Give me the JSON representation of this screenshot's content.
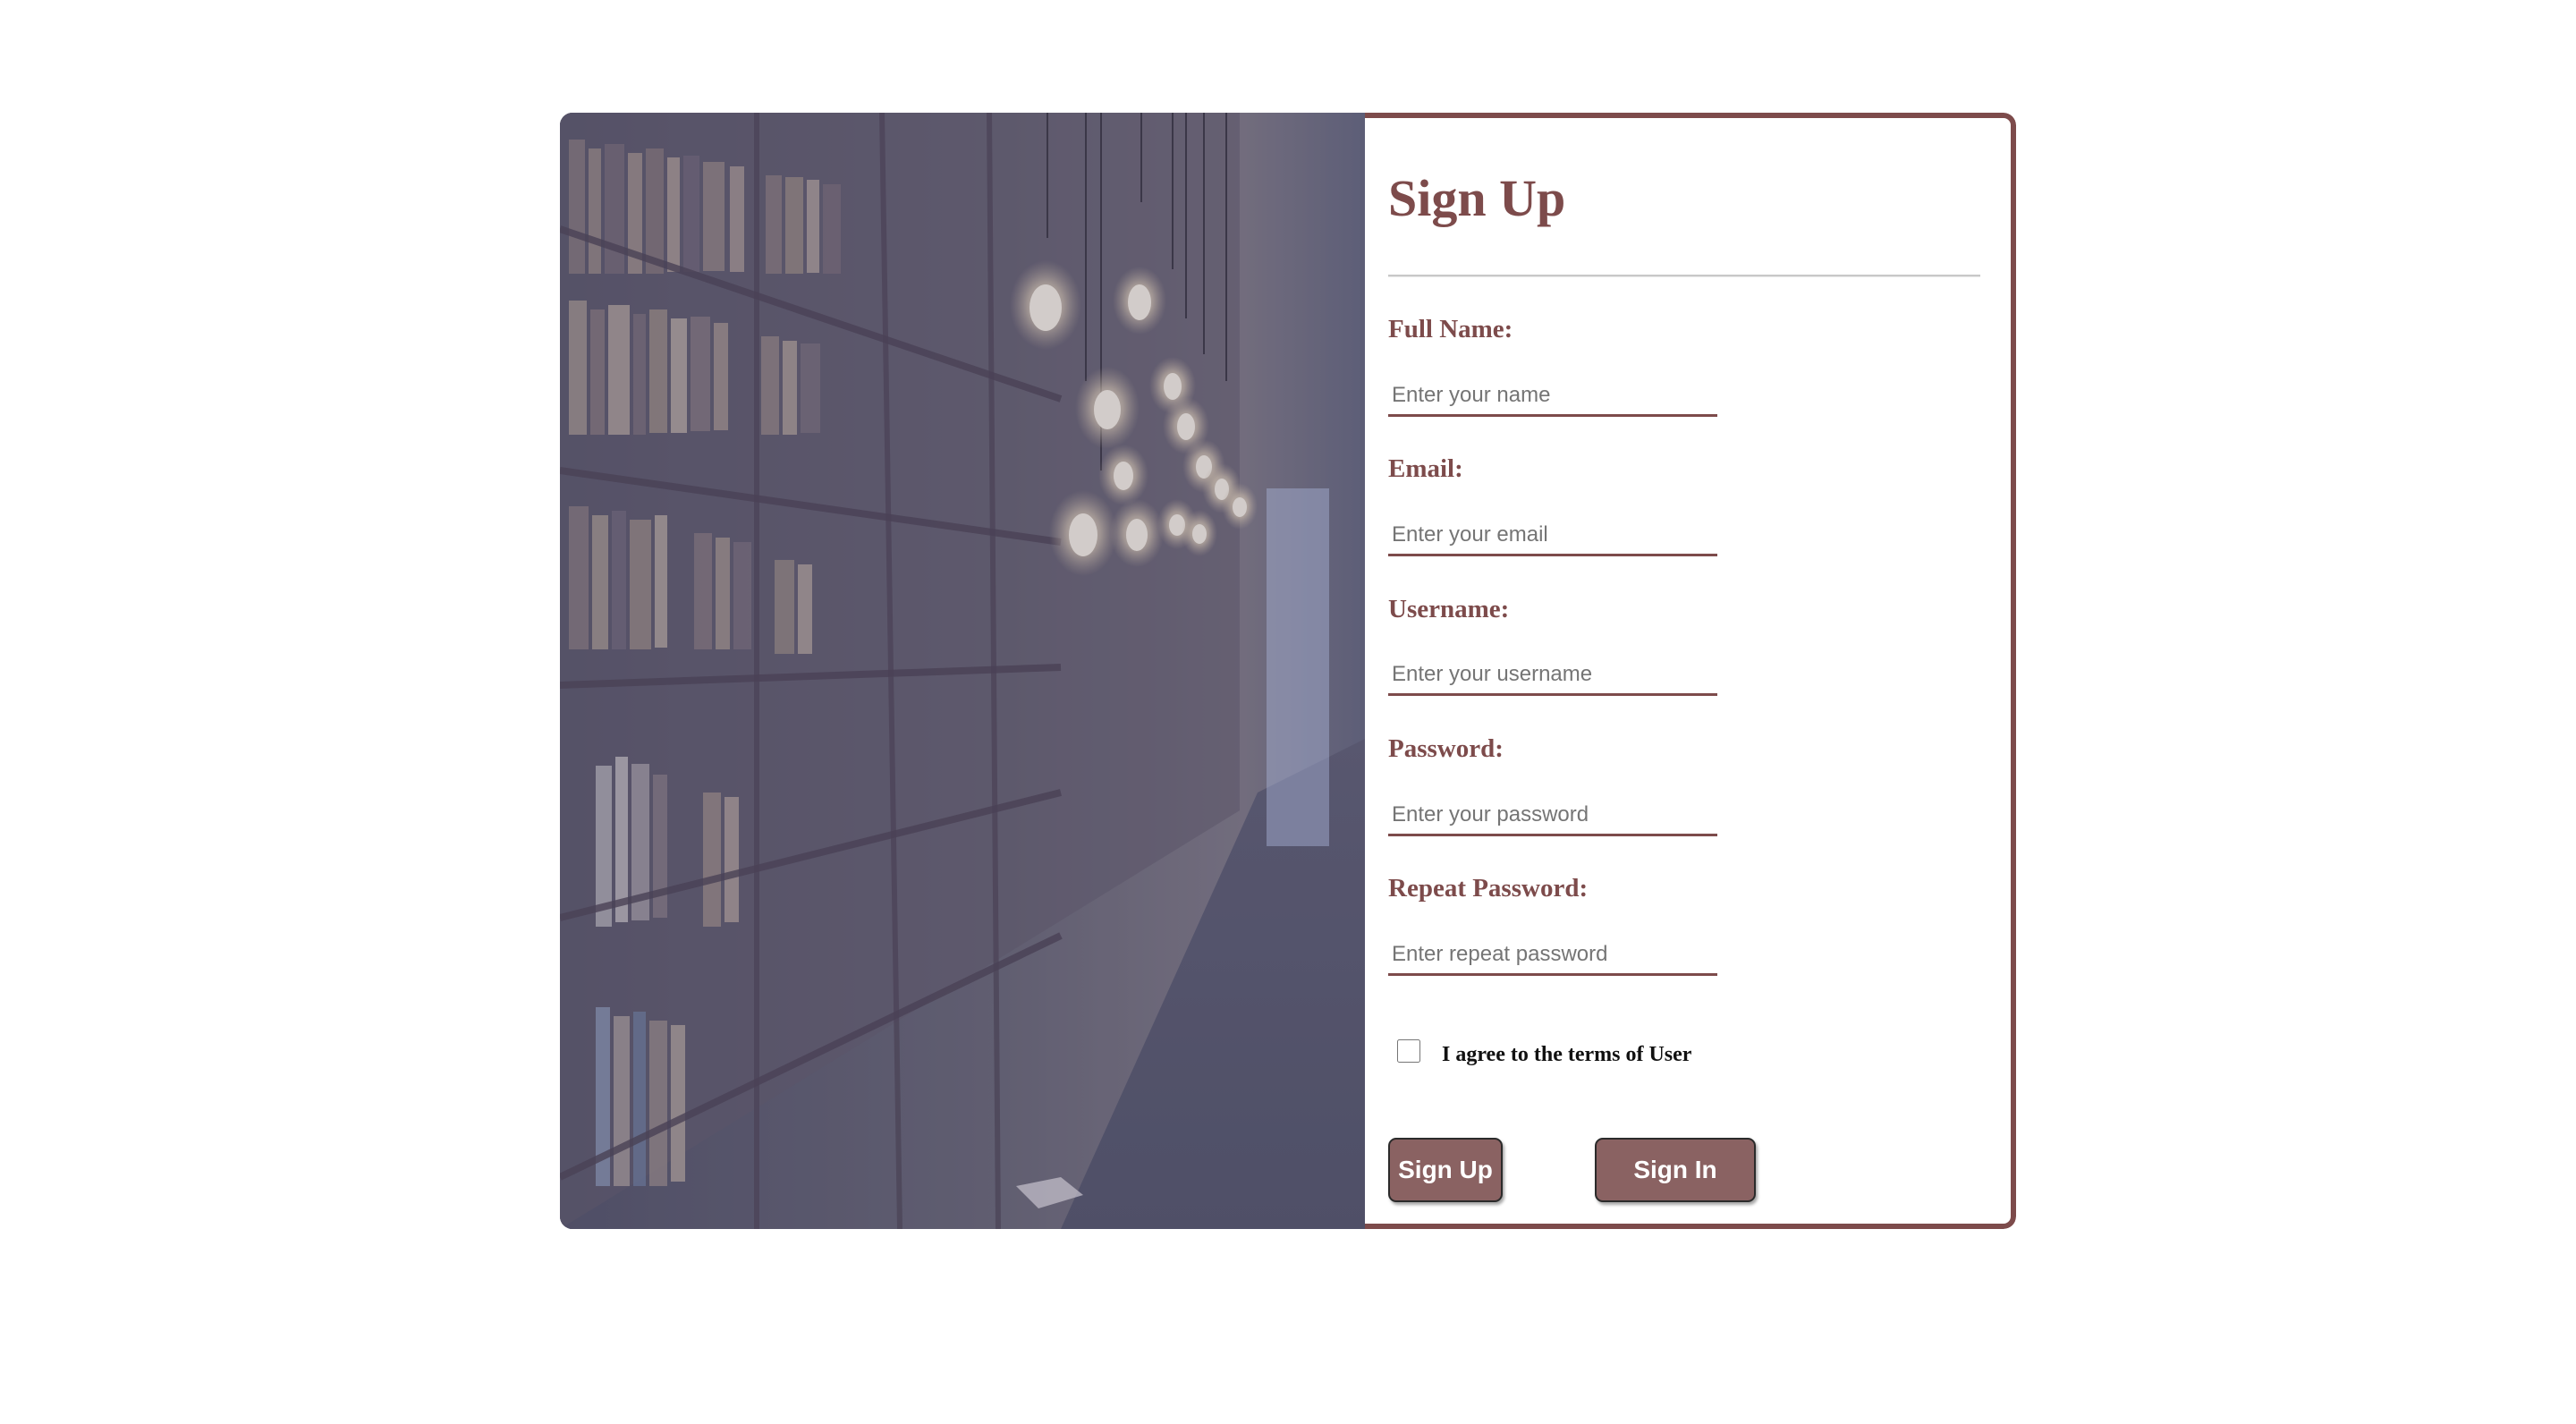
{
  "form": {
    "title": "Sign Up",
    "fields": [
      {
        "label": "Full Name:",
        "placeholder": "Enter your name",
        "value": ""
      },
      {
        "label": "Email:",
        "placeholder": "Enter your email",
        "value": ""
      },
      {
        "label": "Username:",
        "placeholder": "Enter your username",
        "value": ""
      },
      {
        "label": "Password:",
        "placeholder": "Enter your password",
        "value": ""
      },
      {
        "label": "Repeat Password:",
        "placeholder": "Enter repeat password",
        "value": ""
      }
    ],
    "terms_label": "I agree to the terms of User",
    "terms_checked": false,
    "signup_button": "Sign Up",
    "signin_button": "Sign In"
  },
  "colors": {
    "accent": "#7d4b4b",
    "button_fill": "#8a6262",
    "photo_overlay": "#5c5a78"
  },
  "image": {
    "subject": "library-bookshelves-with-hanging-bulbs"
  }
}
